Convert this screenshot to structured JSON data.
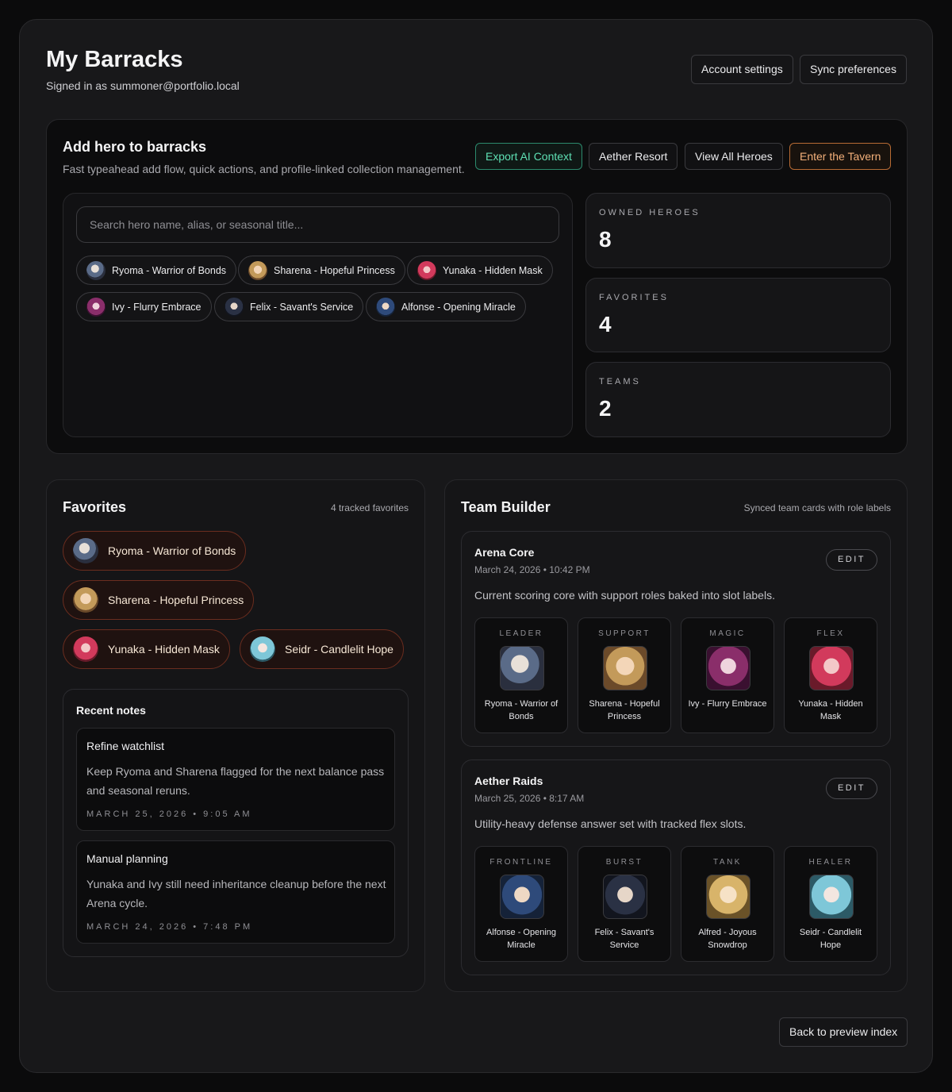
{
  "header": {
    "title": "My Barracks",
    "subtitle": "Signed in as summoner@portfolio.local",
    "account_settings": "Account settings",
    "sync_preferences": "Sync preferences"
  },
  "add_hero": {
    "title": "Add hero to barracks",
    "subtitle": "Fast typeahead add flow, quick actions, and profile-linked collection management.",
    "actions": [
      "Export AI Context",
      "Aether Resort",
      "View All Heroes",
      "Enter the Tavern"
    ],
    "search_placeholder": "Search hero name, alias, or seasonal title...",
    "suggestions": [
      {
        "label": "Ryoma - Warrior of Bonds",
        "icon": "ryoma-avatar"
      },
      {
        "label": "Sharena - Hopeful Princess",
        "icon": "sharena-avatar"
      },
      {
        "label": "Yunaka - Hidden Mask",
        "icon": "yunaka-avatar"
      },
      {
        "label": "Ivy - Flurry Embrace",
        "icon": "ivy-avatar"
      },
      {
        "label": "Felix - Savant's Service",
        "icon": "felix-avatar"
      },
      {
        "label": "Alfonse - Opening Miracle",
        "icon": "alfonse-avatar"
      }
    ]
  },
  "stats": [
    {
      "label": "OWNED HEROES",
      "value": "8"
    },
    {
      "label": "FAVORITES",
      "value": "4"
    },
    {
      "label": "TEAMS",
      "value": "2"
    }
  ],
  "favorites": {
    "title": "Favorites",
    "count_text": "4 tracked favorites",
    "items": [
      {
        "label": "Ryoma - Warrior of Bonds",
        "icon": "ryoma-avatar"
      },
      {
        "label": "Sharena - Hopeful Princess",
        "icon": "sharena-avatar"
      },
      {
        "label": "Yunaka - Hidden Mask",
        "icon": "yunaka-avatar"
      },
      {
        "label": "Seidr - Candlelit Hope",
        "icon": "seidr-avatar"
      }
    ]
  },
  "notes": {
    "title": "Recent notes",
    "items": [
      {
        "title": "Refine watchlist",
        "body": "Keep Ryoma and Sharena flagged for the next balance pass and seasonal reruns.",
        "date": "MARCH 25, 2026 • 9:05 AM"
      },
      {
        "title": "Manual planning",
        "body": "Yunaka and Ivy still need inheritance cleanup before the next Arena cycle.",
        "date": "MARCH 24, 2026 • 7:48 PM"
      }
    ]
  },
  "team_builder": {
    "title": "Team Builder",
    "subtitle": "Synced team cards with role labels",
    "edit_label": "EDIT",
    "teams": [
      {
        "name": "Arena Core",
        "date": "March 24, 2026 • 10:42 PM",
        "description": "Current scoring core with support roles baked into slot labels.",
        "slots": [
          {
            "role": "LEADER",
            "hero": "Ryoma - Warrior of Bonds",
            "icon": "ryoma-portrait"
          },
          {
            "role": "SUPPORT",
            "hero": "Sharena - Hopeful Princess",
            "icon": "sharena-portrait"
          },
          {
            "role": "MAGIC",
            "hero": "Ivy - Flurry Embrace",
            "icon": "ivy-portrait"
          },
          {
            "role": "FLEX",
            "hero": "Yunaka - Hidden Mask",
            "icon": "yunaka-portrait"
          }
        ]
      },
      {
        "name": "Aether Raids",
        "date": "March 25, 2026 • 8:17 AM",
        "description": "Utility-heavy defense answer set with tracked flex slots.",
        "slots": [
          {
            "role": "FRONTLINE",
            "hero": "Alfonse - Opening Miracle",
            "icon": "alfonse-portrait"
          },
          {
            "role": "BURST",
            "hero": "Felix - Savant's Service",
            "icon": "felix-portrait"
          },
          {
            "role": "TANK",
            "hero": "Alfred - Joyous Snowdrop",
            "icon": "alfred-portrait"
          },
          {
            "role": "HEALER",
            "hero": "Seidr - Candlelit Hope",
            "icon": "seidr-portrait"
          }
        ]
      }
    ]
  },
  "footer": {
    "back_label": "Back to preview index"
  },
  "colors": {
    "accent_green": "#5ee0b4",
    "accent_orange": "#f3b07a",
    "favorite_border": "#6b2d1f"
  }
}
